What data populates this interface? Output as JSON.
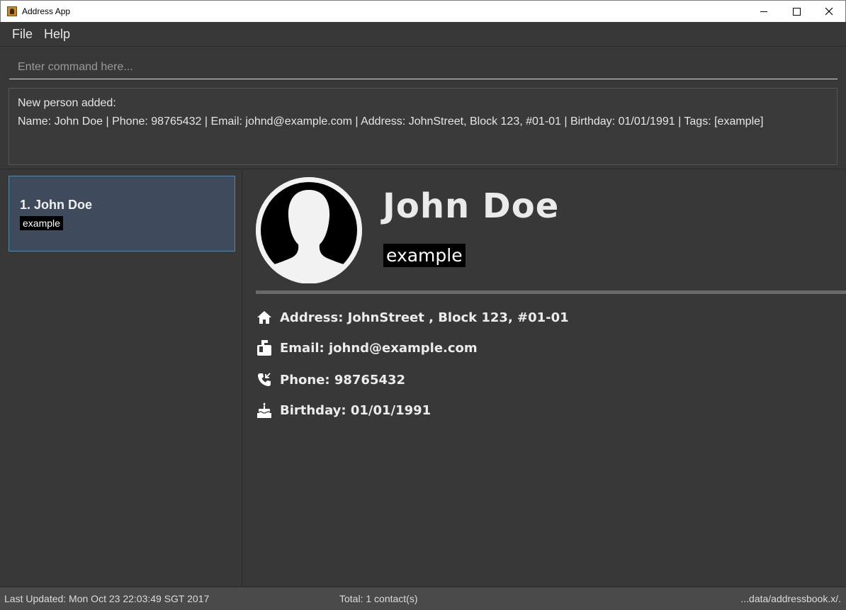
{
  "window": {
    "title": "Address App",
    "controls": [
      "minimize-icon",
      "maximize-icon",
      "close-icon"
    ]
  },
  "menu": {
    "items": [
      "File",
      "Help"
    ]
  },
  "command": {
    "placeholder": "Enter command here...",
    "value": ""
  },
  "result": {
    "line1": "New person added:",
    "line2": "Name: John Doe | Phone: 98765432 | Email: johnd@example.com | Address: JohnStreet, Block 123, #01-01 | Birthday: 01/01/1991 | Tags: [example]"
  },
  "person_list": {
    "items": [
      {
        "index_name": "1.  John Doe",
        "tags": [
          "example"
        ]
      }
    ]
  },
  "detail": {
    "name": "John Doe",
    "tag": "example",
    "address": "Address: JohnStreet , Block 123, #01-01",
    "email": "Email: johnd@example.com",
    "phone": "Phone: 98765432",
    "birthday": "Birthday: 01/01/1991",
    "icons": [
      "home-icon",
      "mailbox-icon",
      "phone-icon",
      "cake-icon"
    ]
  },
  "status": {
    "last_updated": "Last Updated: Mon Oct 23 22:03:49 SGT 2017",
    "total": "Total: 1 contact(s)",
    "file_path": "...data/addressbook.x/."
  },
  "colors": {
    "background": "#383838",
    "selected_card": "#3f4b5c",
    "selected_border": "#5a87a8",
    "tag_bg": "#000000",
    "status_bar": "#4a4a4a"
  }
}
